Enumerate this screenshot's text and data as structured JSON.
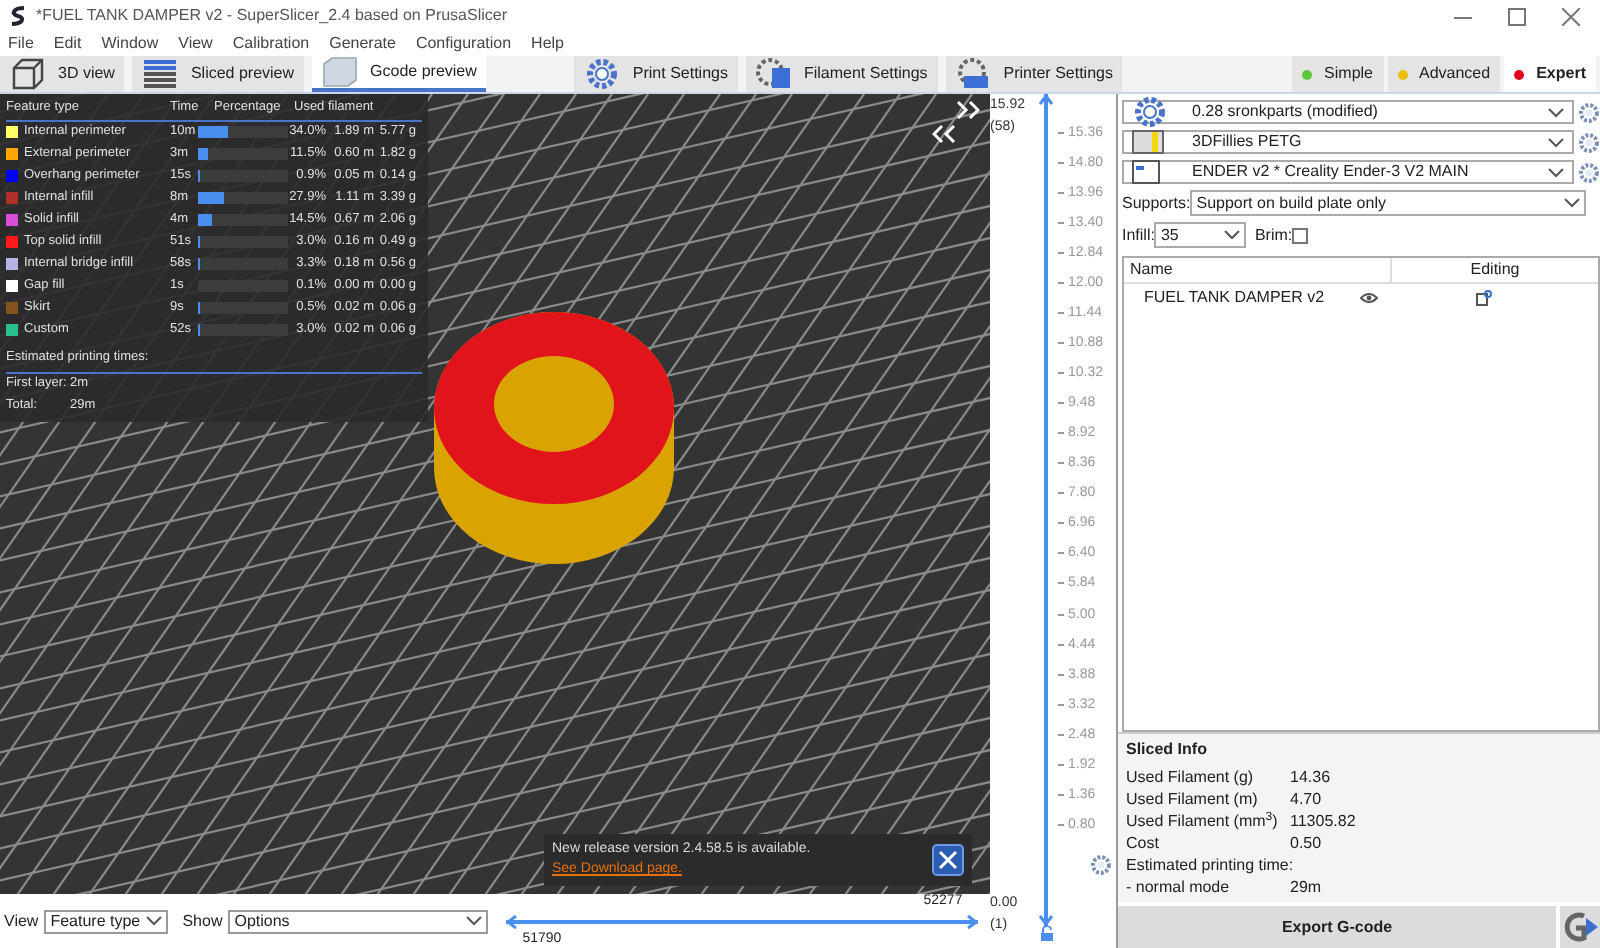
{
  "window": {
    "title": "*FUEL TANK DAMPER v2 - SuperSlicer_2.4  based on PrusaSlicer"
  },
  "menu": [
    "File",
    "Edit",
    "Window",
    "View",
    "Calibration",
    "Generate",
    "Configuration",
    "Help"
  ],
  "tabs": [
    {
      "label": "3D view",
      "kind": "cube",
      "selected": false
    },
    {
      "label": "Sliced preview",
      "kind": "layers",
      "selected": false
    },
    {
      "label": "Gcode preview",
      "kind": "stack",
      "selected": true
    },
    {
      "label": "Print Settings",
      "kind": "gear",
      "selected": false
    },
    {
      "label": "Filament Settings",
      "kind": "spool",
      "selected": false
    },
    {
      "label": "Printer Settings",
      "kind": "printer",
      "selected": false
    }
  ],
  "modes": [
    {
      "label": "Simple",
      "color": "#5cc93b",
      "selected": false
    },
    {
      "label": "Advanced",
      "color": "#e8c000",
      "selected": false
    },
    {
      "label": "Expert",
      "color": "#e0001b",
      "selected": true
    }
  ],
  "legend": {
    "columns": [
      "Feature type",
      "Time",
      "Percentage",
      "Used filament"
    ],
    "rows": [
      {
        "name": "Internal perimeter",
        "color": "#ffff66",
        "time": "10m",
        "level": 0.34,
        "percentage": "34.0%",
        "length": "1.89 m",
        "weight": "5.77 g"
      },
      {
        "name": "External perimeter",
        "color": "#ffa500",
        "time": "3m",
        "level": 0.115,
        "percentage": "11.5%",
        "length": "0.60 m",
        "weight": "1.82 g"
      },
      {
        "name": "Overhang perimeter",
        "color": "#0000ff",
        "time": "15s",
        "level": 0.009,
        "percentage": "0.9%",
        "length": "0.05 m",
        "weight": "0.14 g"
      },
      {
        "name": "Internal infill",
        "color": "#b03029",
        "time": "8m",
        "level": 0.279,
        "percentage": "27.9%",
        "length": "1.11 m",
        "weight": "3.39 g"
      },
      {
        "name": "Solid infill",
        "color": "#d64fd6",
        "time": "4m",
        "level": 0.145,
        "percentage": "14.5%",
        "length": "0.67 m",
        "weight": "2.06 g"
      },
      {
        "name": "Top solid infill",
        "color": "#ff1a1a",
        "time": "51s",
        "level": 0.03,
        "percentage": "3.0%",
        "length": "0.16 m",
        "weight": "0.49 g"
      },
      {
        "name": "Internal bridge infill",
        "color": "#b3b3e6",
        "time": "58s",
        "level": 0.033,
        "percentage": "3.3%",
        "length": "0.18 m",
        "weight": "0.56 g"
      },
      {
        "name": "Gap fill",
        "color": "#ffffff",
        "time": "1s",
        "level": 0.001,
        "percentage": "0.1%",
        "length": "0.00 m",
        "weight": "0.00 g"
      },
      {
        "name": "Skirt",
        "color": "#845321",
        "time": "9s",
        "level": 0.005,
        "percentage": "0.5%",
        "length": "0.02 m",
        "weight": "0.06 g"
      },
      {
        "name": "Custom",
        "color": "#2bbf8c",
        "time": "52s",
        "level": 0.03,
        "percentage": "3.0%",
        "length": "0.02 m",
        "weight": "0.06 g"
      }
    ],
    "estimated_label": "Estimated printing times:",
    "times": [
      {
        "label": "First layer:",
        "value": "2m"
      },
      {
        "label": "Total:",
        "value": "29m"
      }
    ]
  },
  "layer_slider": {
    "level": 1,
    "top_value": "15.92",
    "top_layer": "(58)",
    "ticks": [
      "15.36",
      "14.80",
      "13.96",
      "13.40",
      "12.84",
      "12.00",
      "11.44",
      "10.88",
      "10.32",
      "9.48",
      "8.92",
      "8.36",
      "7.80",
      "6.96",
      "6.40",
      "5.84",
      "5.00",
      "4.44",
      "3.88",
      "3.32",
      "2.48",
      "1.92",
      "1.36",
      "0.80"
    ],
    "bottom_value": "0.00",
    "bottom_layer": "(1)"
  },
  "notification": {
    "message": "New release version 2.4.58.5 is available.",
    "link": "See Download page."
  },
  "bottom_bar": {
    "level": 1,
    "view_label": "View",
    "view_value": "Feature type",
    "show_label": "Show",
    "show_value": "Options",
    "move_end": "52277",
    "move_start": "51790"
  },
  "presets": [
    {
      "kind": "print",
      "value": "0.28 sronkparts (modified)"
    },
    {
      "kind": "filament",
      "value": "3DFillies PETG"
    },
    {
      "kind": "printer",
      "value": "ENDER v2 * Creality Ender-3 V2 MAIN"
    }
  ],
  "supports": {
    "label": "Supports:",
    "value": "Support on build plate only"
  },
  "infill": {
    "label": "Infill:",
    "value": "35"
  },
  "brim": {
    "label": "Brim:",
    "checked": false
  },
  "objects": {
    "columns": [
      "Name",
      "Editing"
    ],
    "rows": [
      {
        "name": "FUEL TANK DAMPER v2"
      }
    ]
  },
  "sliced_info": {
    "title": "Sliced Info",
    "rows": [
      {
        "label": "Used Filament (g)",
        "value": "14.36"
      },
      {
        "label": "Used Filament (m)",
        "value": "4.70"
      },
      {
        "label": "Used Filament (mm$^{3}$)",
        "value": "11305.82"
      },
      {
        "label": "Cost",
        "value": "0.50"
      },
      {
        "label": "Estimated printing time:"
      },
      {
        "label": "- normal mode",
        "value": "29m"
      }
    ]
  },
  "export_label": "Export G-code"
}
